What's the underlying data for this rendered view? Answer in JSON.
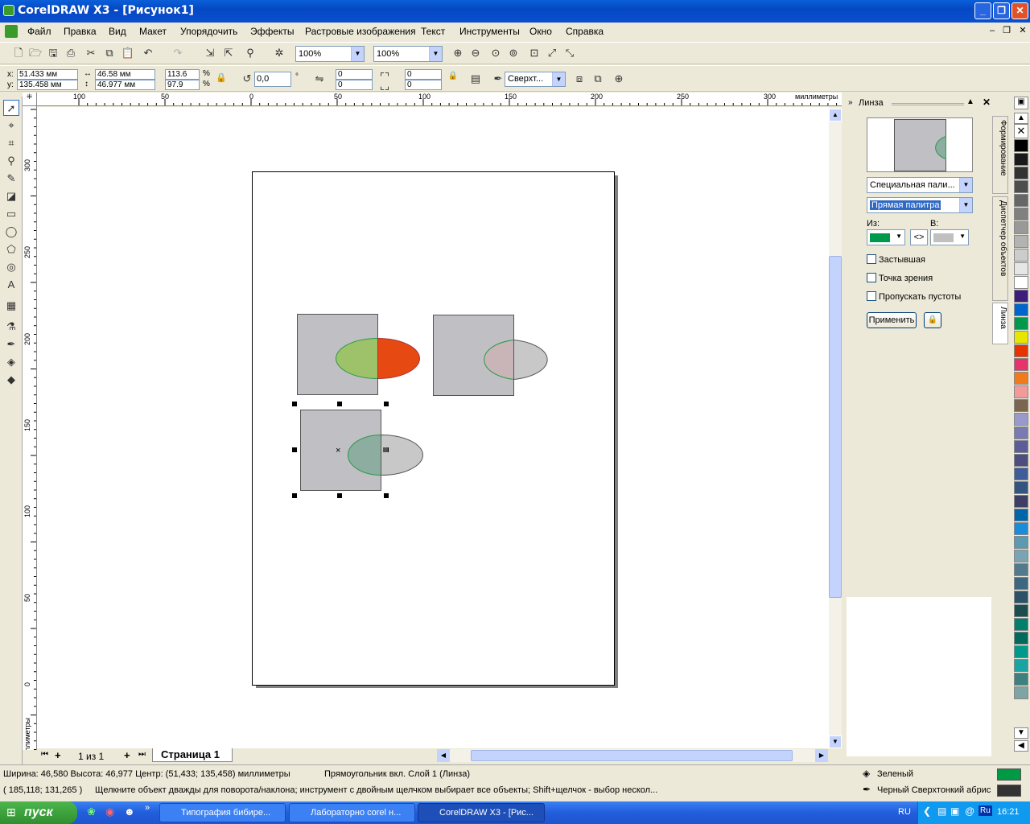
{
  "window": {
    "title": "CorelDRAW X3 - [Рисунок1]"
  },
  "menu": [
    "Файл",
    "Правка",
    "Вид",
    "Макет",
    "Упорядочить",
    "Эффекты",
    "Растровые изображения",
    "Текст",
    "Инструменты",
    "Окно",
    "Справка"
  ],
  "toolbar": {
    "zoom1": "100%",
    "zoom2": "100%"
  },
  "propbar": {
    "x": "51.433 мм",
    "y": "135.458 мм",
    "w": "46.58 мм",
    "h": "46.977 мм",
    "sx": "113.6",
    "sy": "97.9",
    "pct": "%",
    "angle": "0,0",
    "deg": "°",
    "r1": "0",
    "r2": "0",
    "r3": "0",
    "r4": "0",
    "wrap": "Сверхт..."
  },
  "ruler": {
    "h_labels": [
      "100",
      "50",
      "0",
      "50",
      "100",
      "150",
      "200",
      "250",
      "300"
    ],
    "h_unit": "миллиметры",
    "v_labels": [
      "300",
      "250",
      "200",
      "150",
      "100",
      "50",
      "0"
    ],
    "v_unit": "миллиметры"
  },
  "pagenav": {
    "counter": "1 из 1",
    "tab": "Страница 1"
  },
  "docker": {
    "title": "Линза",
    "preset": "Специальная пали...",
    "mode": "Прямая палитра",
    "from_label": "Из:",
    "to_label": "В:",
    "from_color": "#00994c",
    "to_color": "#c0c0c0",
    "swap": "<>",
    "opt1": "Застывшая",
    "opt2": "Точка зрения",
    "opt3": "Пропускать пустоты",
    "apply": "Применить"
  },
  "dock_tabs": {
    "t1": "Формирование",
    "t2": "Диспетчер объектов",
    "t3": "Линза"
  },
  "palette": [
    "#000000",
    "#1a1a1a",
    "#333333",
    "#4d4d4d",
    "#666666",
    "#808080",
    "#999999",
    "#b3b3b3",
    "#cccccc",
    "#e6e6e6",
    "#ffffff",
    "#3d1f7a",
    "#0066cc",
    "#00994c",
    "#e6e600",
    "#e63300",
    "#e6336b",
    "#f27a1a",
    "#f29999",
    "#7a6650",
    "#9999cc",
    "#7a7ab3",
    "#5c5c99",
    "#4d4d80",
    "#3d5c99",
    "#335580",
    "#3d3d66",
    "#0066aa",
    "#1a8cd9",
    "#5c99b3",
    "#7aa3b3",
    "#527a8c",
    "#3d6680",
    "#2b5266",
    "#1a4d4d",
    "#00806b",
    "#006b5c",
    "#00998c",
    "#1aa3a3",
    "#3d8080",
    "#80a3a3"
  ],
  "status": {
    "line1": "Ширина: 46,580  Высота: 46,977  Центр: (51,433; 135,458)  миллиметры",
    "obj": "Прямоугольник вкл. Слой 1  (Линза)",
    "coords": "( 185,118; 131,265 )",
    "hint": "Щелкните объект дважды для поворота/наклона; инструмент с двойным щелчком выбирает все объекты; Shift+щелчок - выбор нескол...",
    "fill": "Зеленый",
    "outline": "Черный  Сверхтонкий абрис",
    "fill_color": "#009944",
    "outline_color": "#333333"
  },
  "taskbar": {
    "start": "пуск",
    "t1": "Типография бибире...",
    "t2": "Лабораторно corel н...",
    "t3": "CorelDRAW X3 - [Рис...",
    "lang": "RU",
    "time": "16:21",
    "ru": "Ru"
  }
}
